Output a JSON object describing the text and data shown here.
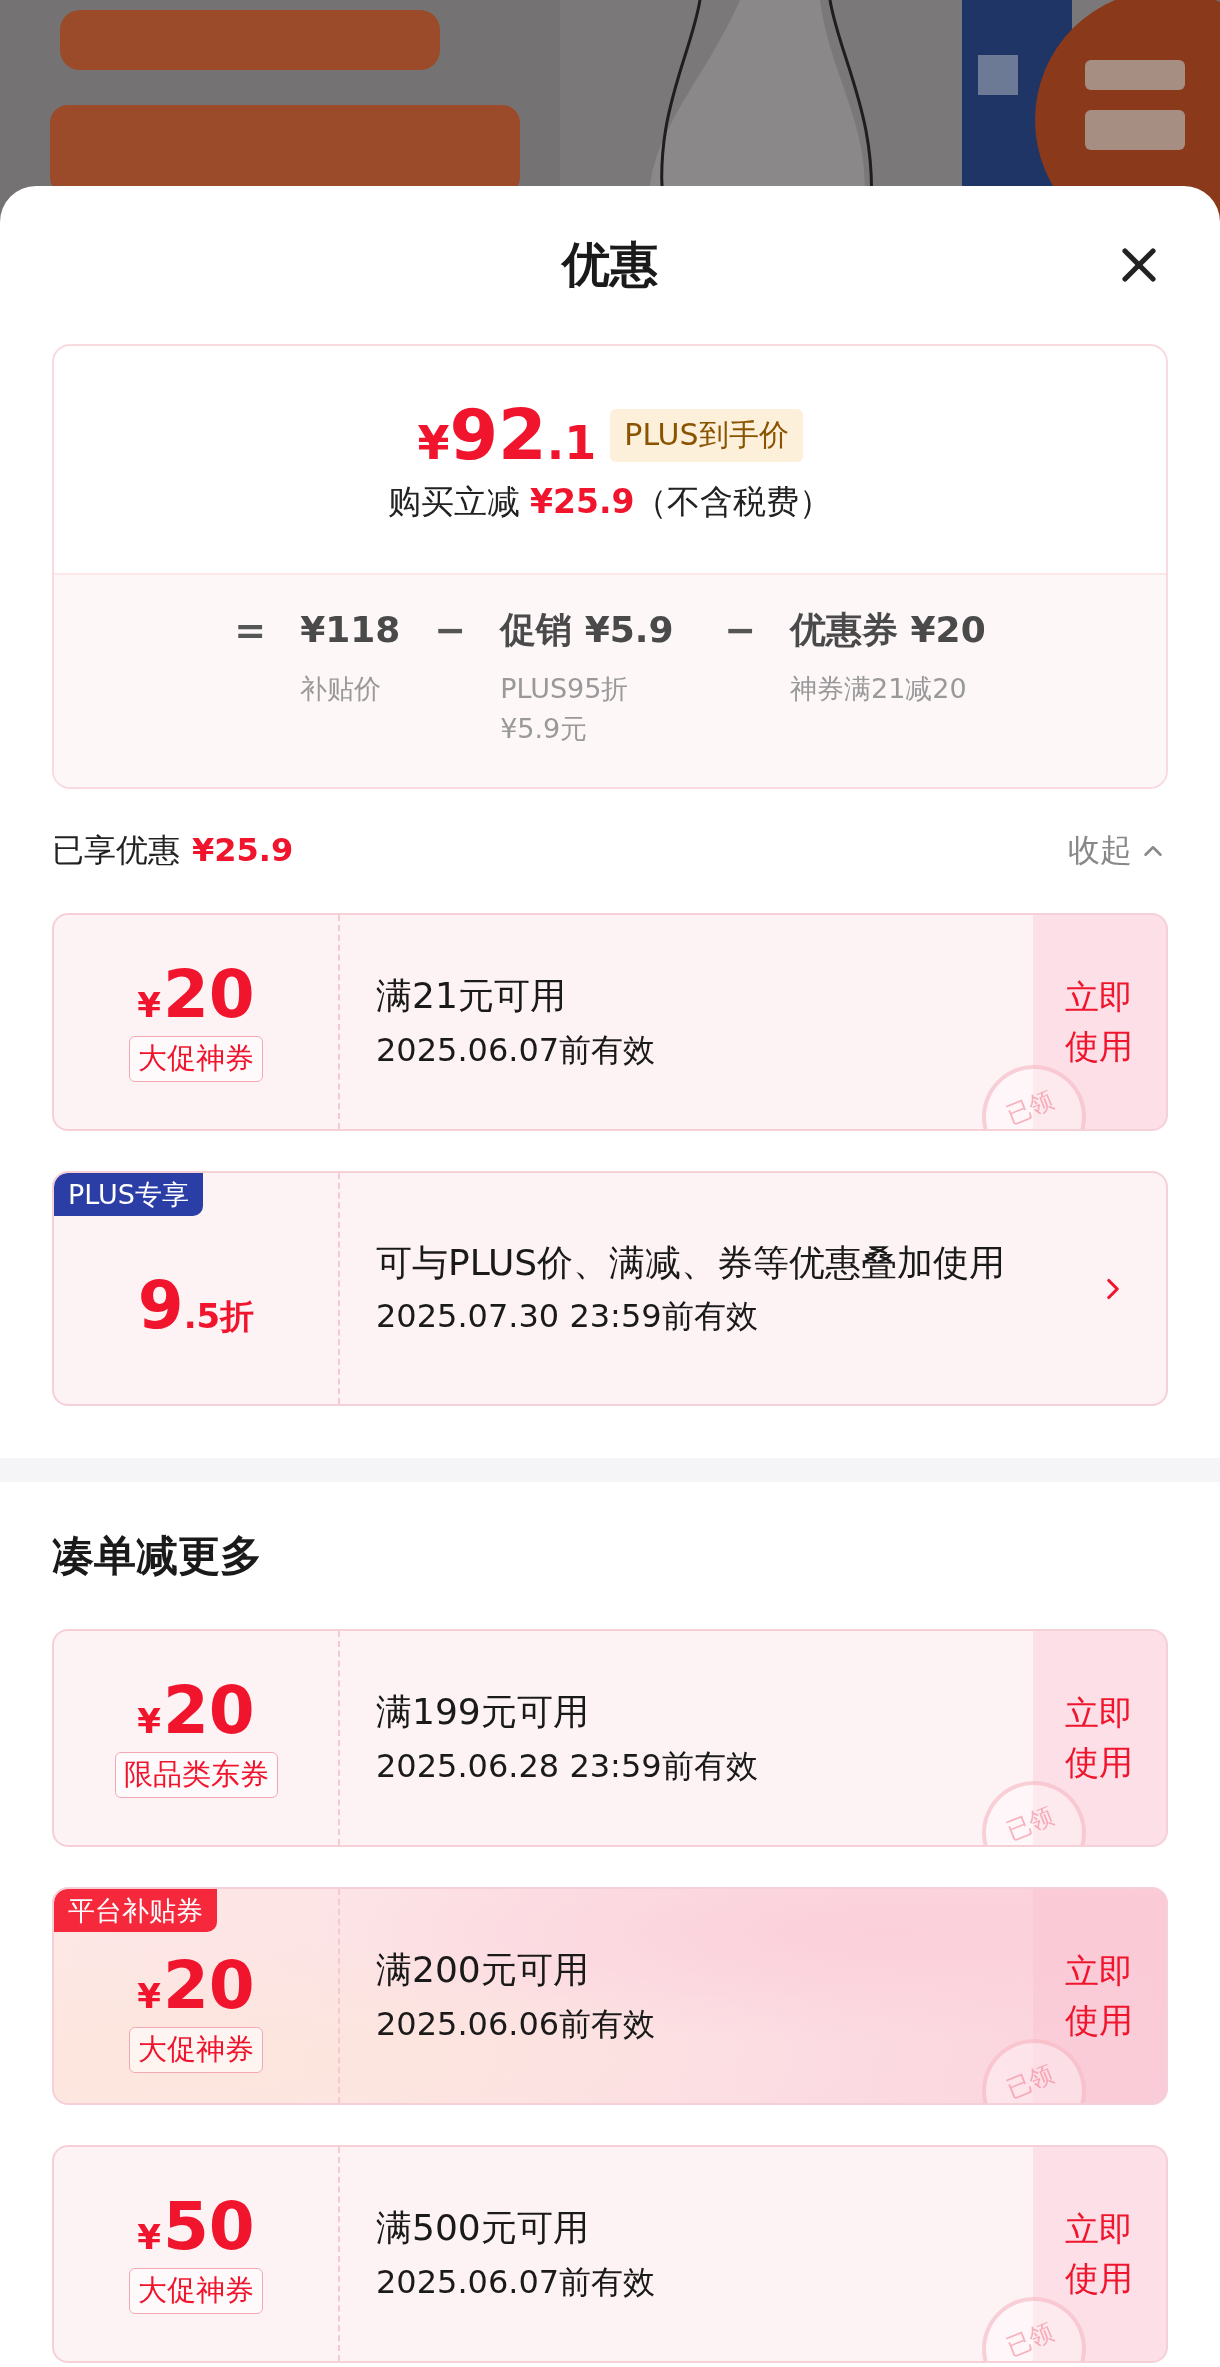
{
  "sheet": {
    "title": "优惠"
  },
  "summary": {
    "price": {
      "symbol": "¥",
      "integer": "92",
      "fraction": ".1"
    },
    "price_tag": "PLUS到手价",
    "saving": {
      "prefix": "购买立减",
      "amount": "¥25.9",
      "suffix": "（不含税费）"
    },
    "breakdown": [
      {
        "operator": "=",
        "value": "¥118",
        "note": "补贴价"
      },
      {
        "operator": "−",
        "value": "促销 ¥5.9",
        "note": "PLUS95折 ¥5.9元"
      },
      {
        "operator": "−",
        "value": "优惠券 ¥20",
        "note": "神券满21减20"
      }
    ]
  },
  "enjoyed": {
    "label": "已享优惠",
    "amount": "¥25.9",
    "toggle": "收起",
    "expanded": true
  },
  "coupons": [
    {
      "kind": "amount",
      "symbol": "¥",
      "value": "20",
      "tag": "大促神券",
      "condition": "满21元可用",
      "validity": "2025.06.07前有效",
      "action": "立即使用",
      "stamp": "已领",
      "highlighted": false
    },
    {
      "kind": "discount",
      "value": "9",
      "fraction": ".5折",
      "badge": {
        "text": "PLUS专享",
        "color": "#2b3ea6"
      },
      "condition": "可与PLUS价、满减、券等优惠叠加使用",
      "validity": "2025.07.30 23:59前有效",
      "highlighted": false
    }
  ],
  "more_section": {
    "title": "凑单减更多",
    "coupons": [
      {
        "kind": "amount",
        "symbol": "¥",
        "value": "20",
        "tag": "限品类东券",
        "condition": "满199元可用",
        "validity": "2025.06.28 23:59前有效",
        "action": "立即使用",
        "stamp": "已领",
        "highlighted": false
      },
      {
        "kind": "amount",
        "symbol": "¥",
        "value": "20",
        "tag": "大促神券",
        "badge": {
          "text": "平台补贴券",
          "color": "#f5283c"
        },
        "condition": "满200元可用",
        "validity": "2025.06.06前有效",
        "action": "立即使用",
        "stamp": "已领",
        "highlighted": true
      },
      {
        "kind": "amount",
        "symbol": "¥",
        "value": "50",
        "tag": "大促神券",
        "condition": "满500元可用",
        "validity": "2025.06.07前有效",
        "action": "立即使用",
        "stamp": "已领",
        "highlighted": false
      }
    ]
  }
}
